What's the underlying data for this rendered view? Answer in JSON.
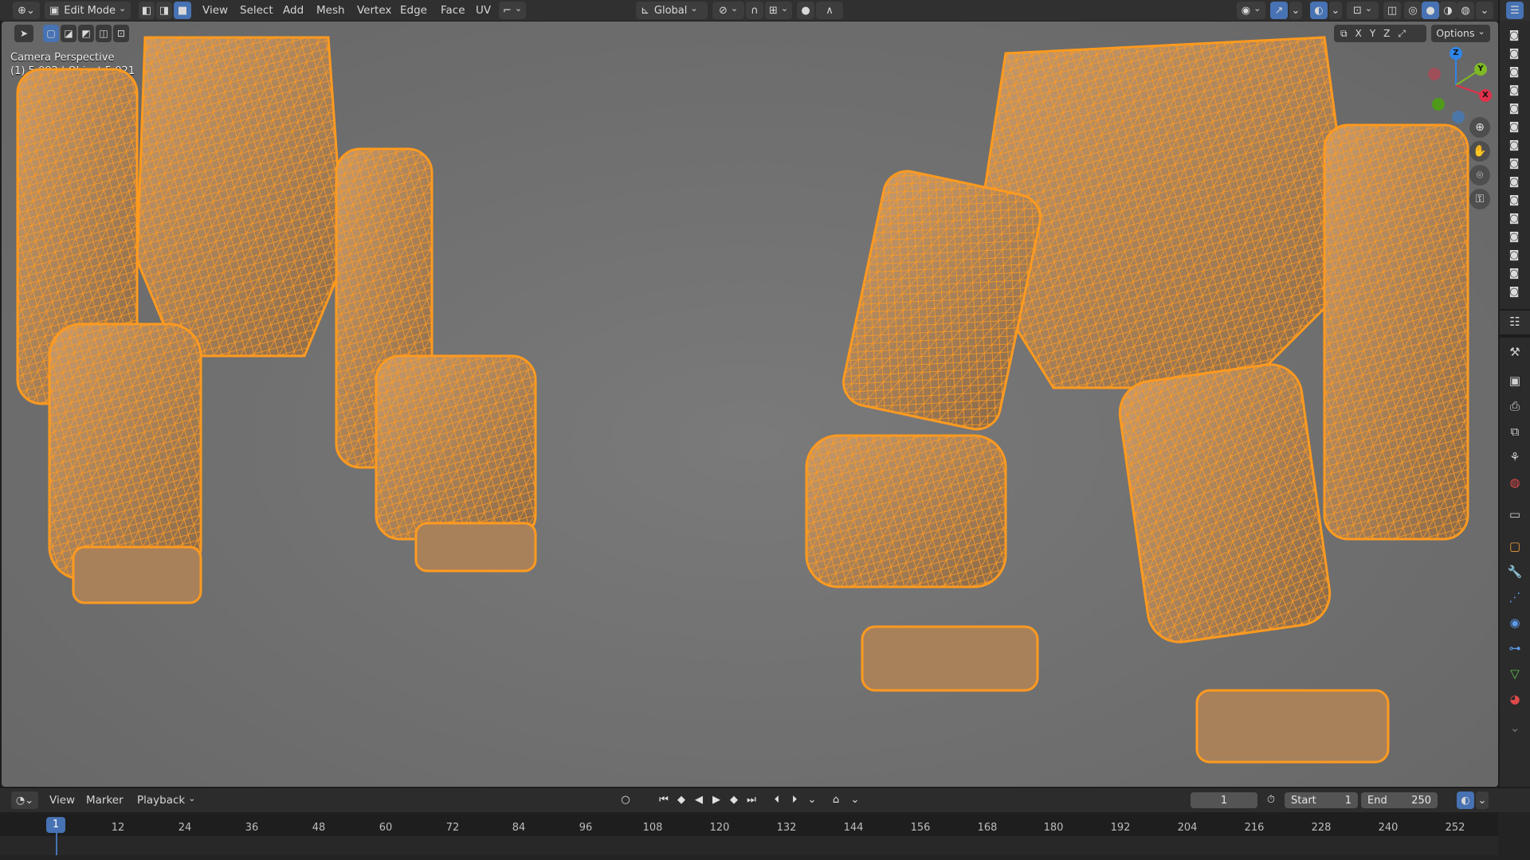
{
  "header": {
    "mode_label": "Edit Mode",
    "menus": [
      "View",
      "Select",
      "Add",
      "Mesh",
      "Vertex",
      "Edge",
      "Face",
      "UV"
    ],
    "transform_orientation": "Global",
    "options_label": "Options",
    "axis_labels": [
      "X",
      "Y",
      "Z"
    ]
  },
  "viewport": {
    "perspective_label": "Camera Perspective",
    "info_label": "(1) 5.002 | Object 5.021",
    "wire_color": "#ff9a1f",
    "mesh_color": "#b58a5a"
  },
  "gizmo": {
    "x": "X",
    "y": "Y",
    "z": "Z",
    "x_color": "#e0304a",
    "y_color": "#7fba25",
    "z_color": "#2e86e8"
  },
  "timeline": {
    "menus": [
      "View",
      "Marker",
      "Playback"
    ],
    "current_frame": "1",
    "start_label": "Start",
    "start_value": "1",
    "end_label": "End",
    "end_value": "250",
    "ticks": [
      "1",
      "12",
      "24",
      "36",
      "48",
      "60",
      "72",
      "84",
      "96",
      "108",
      "120",
      "132",
      "144",
      "156",
      "168",
      "180",
      "192",
      "204",
      "216",
      "228",
      "240",
      "252"
    ]
  },
  "colors": {
    "accent": "#4772b3",
    "header": "#303030",
    "viewport": "#6c6c6c"
  }
}
